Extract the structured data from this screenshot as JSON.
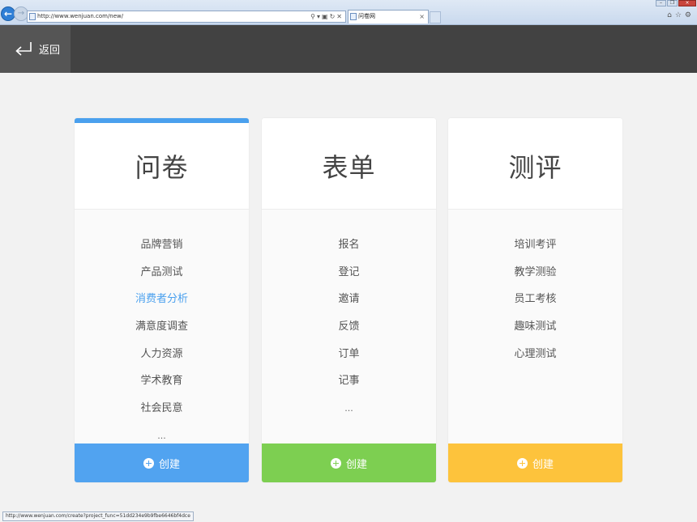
{
  "browser": {
    "url": "http://www.wenjuan.com/new/",
    "tab_title": "问卷网",
    "status_url": "http://www.wenjuan.com/create?project_func=51dd234e9b9fbe6646bf4dce"
  },
  "header": {
    "back_label": "返回"
  },
  "cards": [
    {
      "title": "问卷",
      "items": [
        "品牌营销",
        "产品测试",
        "消费者分析",
        "满意度调查",
        "人力资源",
        "学术教育",
        "社会民意",
        "..."
      ],
      "active_item": "消费者分析",
      "create_label": "创建",
      "color": "#51a3f0"
    },
    {
      "title": "表单",
      "items": [
        "报名",
        "登记",
        "邀请",
        "反馈",
        "订单",
        "记事",
        "..."
      ],
      "create_label": "创建",
      "color": "#7dcf51"
    },
    {
      "title": "测评",
      "items": [
        "培训考评",
        "教学测验",
        "员工考核",
        "趣味测试",
        "心理测试"
      ],
      "create_label": "创建",
      "color": "#fdc33c"
    }
  ],
  "colors": {
    "accent_blue": "#4aa0ee",
    "header_bg": "#424242"
  }
}
